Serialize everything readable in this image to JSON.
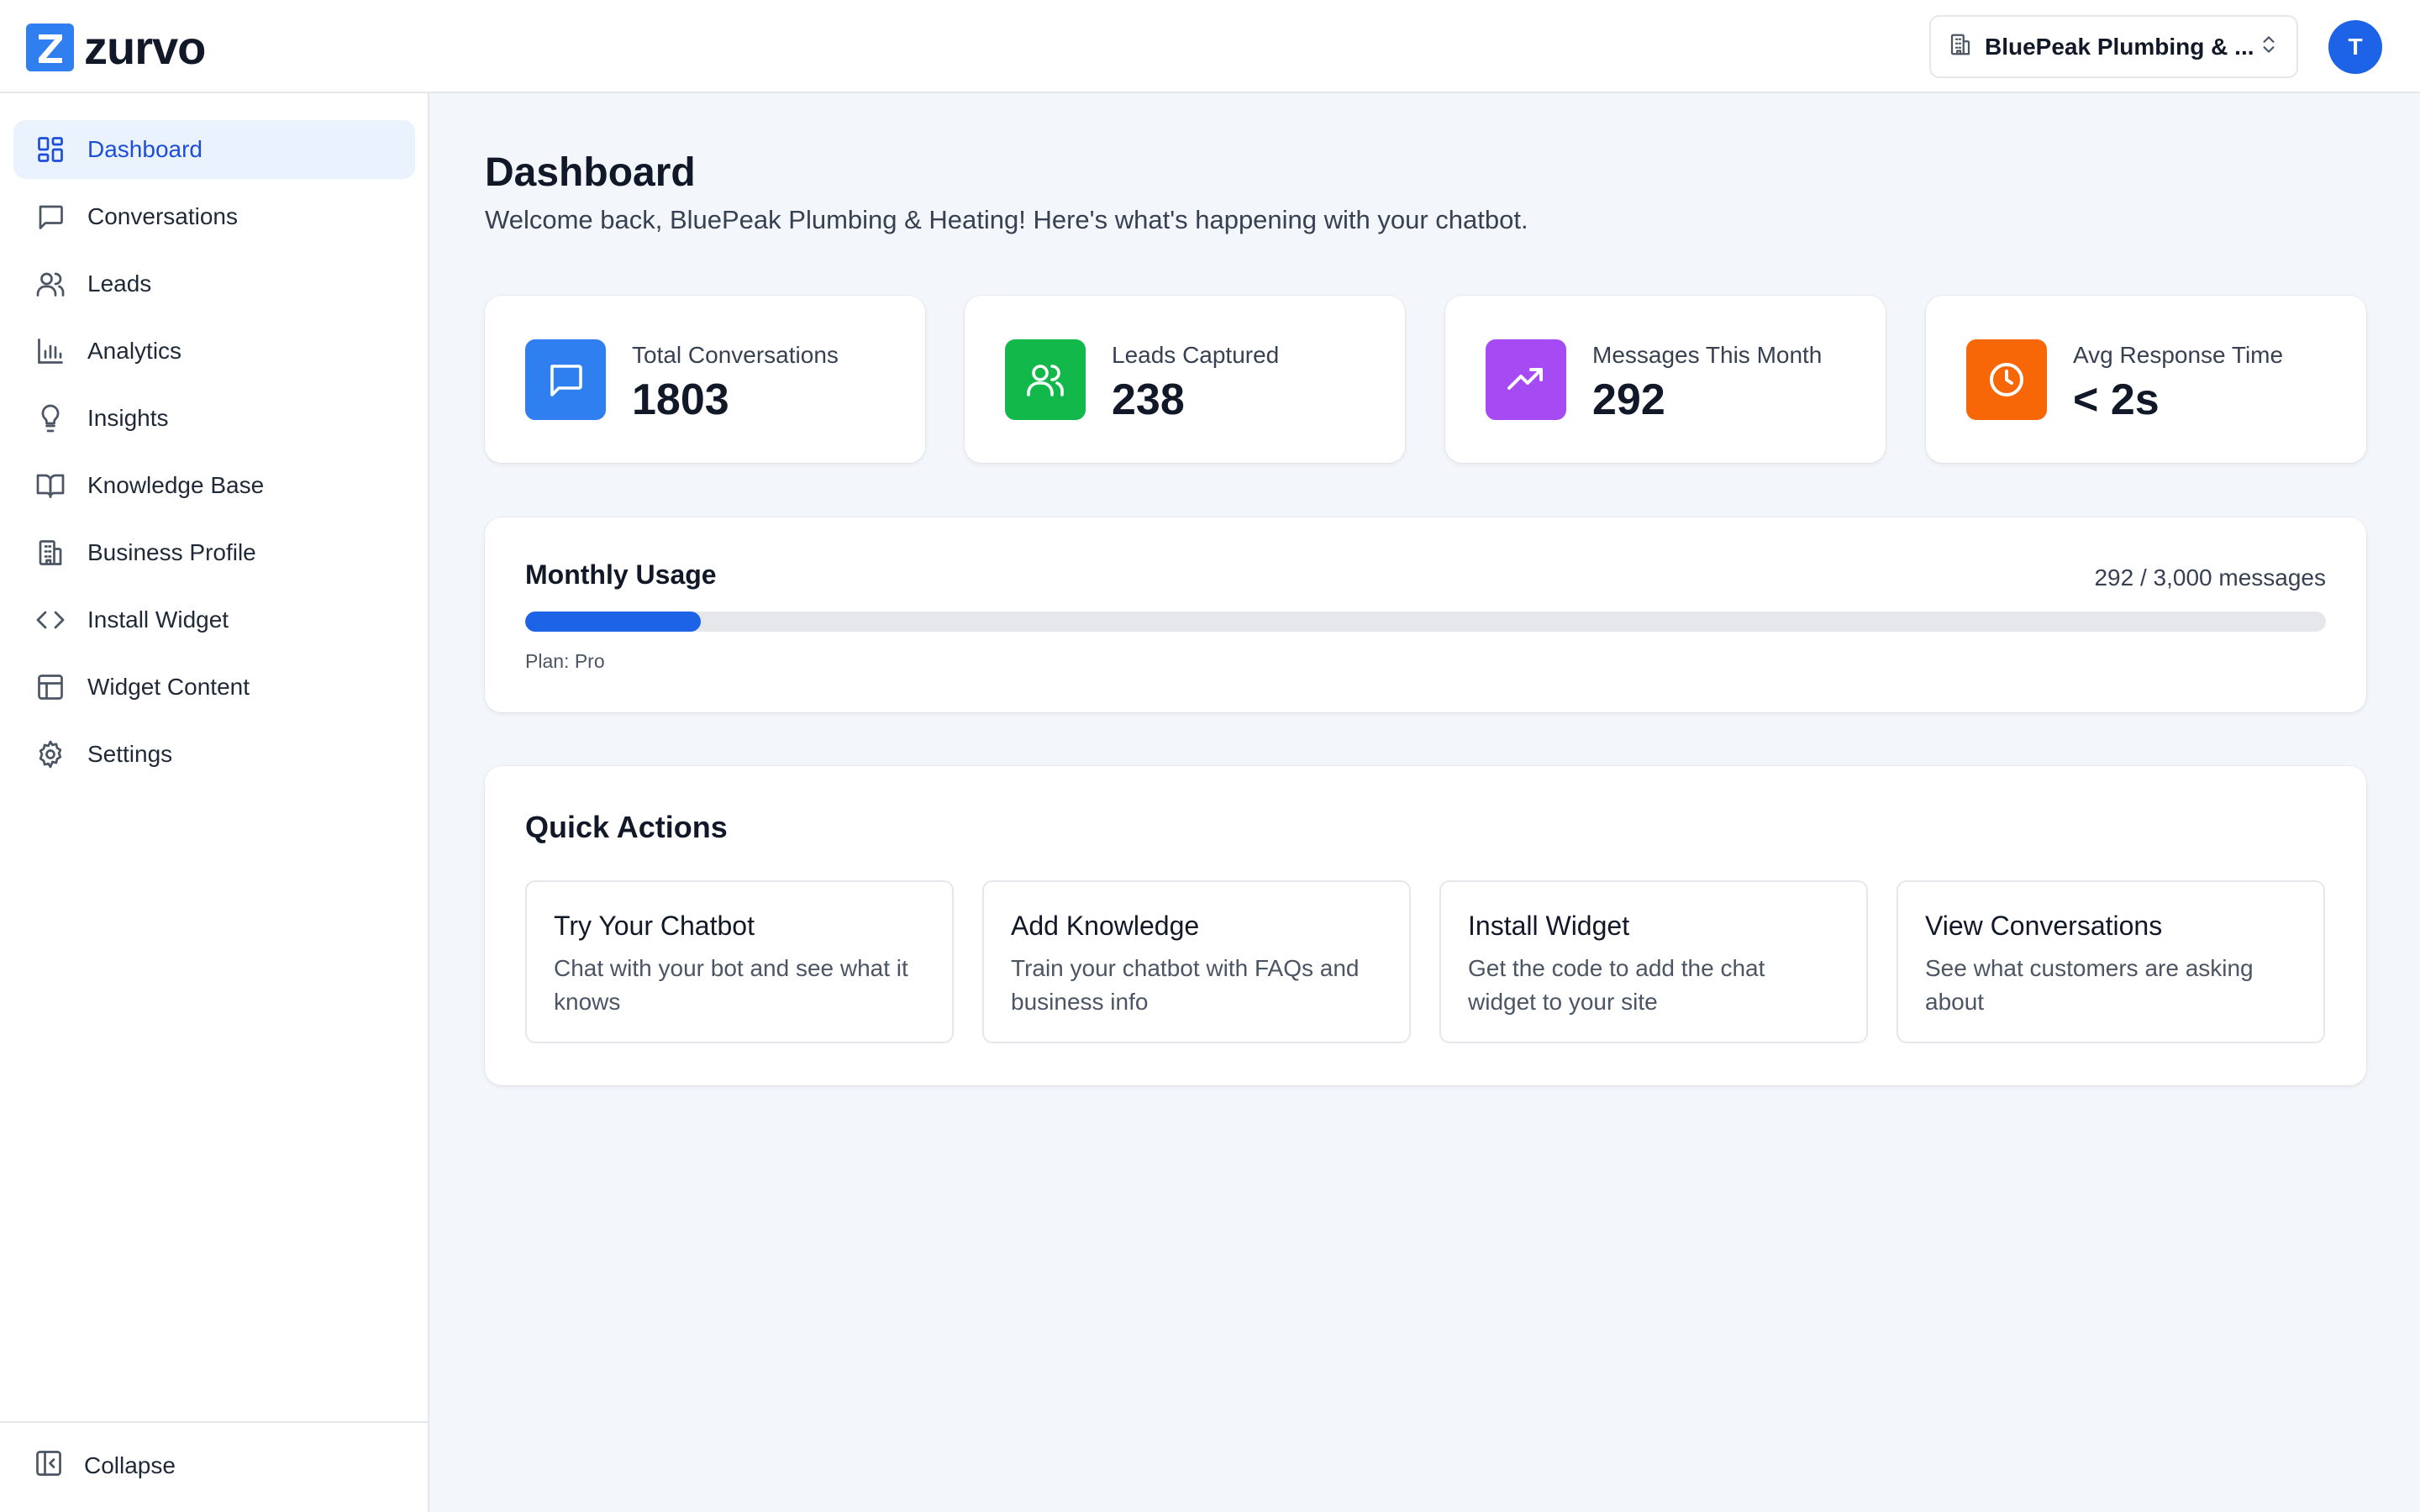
{
  "app": {
    "logo_text": "zurvo",
    "logo_letter": "Z",
    "brand_color": "#2f7ff0"
  },
  "header": {
    "business_name": "BluePeak Plumbing & ...",
    "avatar_initial": "T"
  },
  "sidebar": {
    "items": [
      {
        "label": "Dashboard",
        "icon": "dashboard-icon",
        "active": true
      },
      {
        "label": "Conversations",
        "icon": "chat-icon"
      },
      {
        "label": "Leads",
        "icon": "users-icon"
      },
      {
        "label": "Analytics",
        "icon": "bar-chart-icon"
      },
      {
        "label": "Insights",
        "icon": "lightbulb-icon"
      },
      {
        "label": "Knowledge Base",
        "icon": "book-icon"
      },
      {
        "label": "Business Profile",
        "icon": "building-icon"
      },
      {
        "label": "Install Widget",
        "icon": "code-icon"
      },
      {
        "label": "Widget Content",
        "icon": "layout-icon"
      },
      {
        "label": "Settings",
        "icon": "gear-icon"
      }
    ],
    "collapse_label": "Collapse"
  },
  "main": {
    "title": "Dashboard",
    "subtitle": "Welcome back, BluePeak Plumbing & Heating! Here's what's happening with your chatbot.",
    "stats": [
      {
        "label": "Total Conversations",
        "value": "1803",
        "icon": "chat-icon",
        "color": "#2f7ff0"
      },
      {
        "label": "Leads Captured",
        "value": "238",
        "icon": "users-icon",
        "color": "#12b94a"
      },
      {
        "label": "Messages This Month",
        "value": "292",
        "icon": "trend-up-icon",
        "color": "#a64bf4"
      },
      {
        "label": "Avg Response Time",
        "value": "< 2s",
        "icon": "clock-icon",
        "color": "#f76707"
      }
    ],
    "usage": {
      "title": "Monthly Usage",
      "count_text": "292 / 3,000 messages",
      "used": 292,
      "limit": 3000,
      "fill_fraction": 0.0973,
      "plan_text": "Plan: Pro"
    },
    "quick_actions": {
      "title": "Quick Actions",
      "items": [
        {
          "title": "Try Your Chatbot",
          "desc": "Chat with your bot and see what it knows"
        },
        {
          "title": "Add Knowledge",
          "desc": "Train your chatbot with FAQs and business info"
        },
        {
          "title": "Install Widget",
          "desc": "Get the code to add the chat widget to your site"
        },
        {
          "title": "View Conversations",
          "desc": "See what customers are asking about"
        }
      ]
    }
  }
}
